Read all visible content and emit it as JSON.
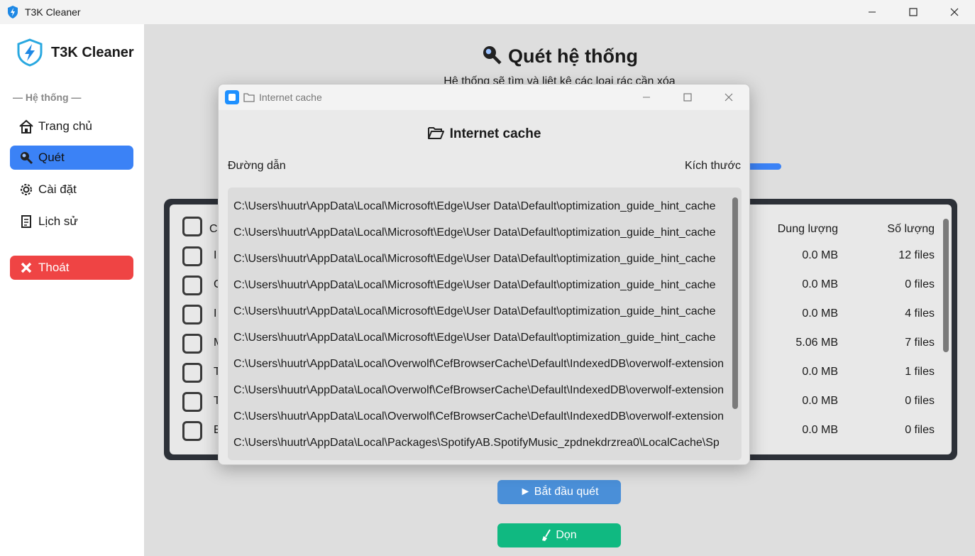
{
  "window": {
    "title": "T3K Cleaner",
    "icon": "lightning-shield-icon"
  },
  "sidebar": {
    "brand": "T3K Cleaner",
    "section_label": "— Hệ thống —",
    "items": [
      {
        "label": "Trang chủ",
        "icon": "house-icon"
      },
      {
        "label": "Quét",
        "icon": "magnifier-icon",
        "active": true
      },
      {
        "label": "Cài đặt",
        "icon": "gear-icon"
      },
      {
        "label": "Lịch sử",
        "icon": "scroll-icon"
      }
    ],
    "exit": {
      "label": "Thoát",
      "icon": "cross-icon"
    }
  },
  "main": {
    "title": "Quét hệ thống",
    "subtitle": "Hệ thống sẽ tìm và liệt kê các loại rác cần xóa",
    "table": {
      "headers": {
        "first": "Cl",
        "size": "Dung lượng",
        "count": "Số lượng"
      },
      "rows": [
        {
          "label": "I",
          "size": "0.0 MB",
          "count": "12 files"
        },
        {
          "label": "C",
          "size": "0.0 MB",
          "count": "0 files"
        },
        {
          "label": "I",
          "size": "0.0 MB",
          "count": "4 files"
        },
        {
          "label": "M",
          "size": "5.06 MB",
          "count": "7 files"
        },
        {
          "label": "T",
          "size": "0.0 MB",
          "count": "1 files"
        },
        {
          "label": "T",
          "size": "0.0 MB",
          "count": "0 files"
        },
        {
          "label": "E",
          "size": "0.0 MB",
          "count": "0 files"
        }
      ]
    },
    "scan_button": "► Bắt đầu quét",
    "clean_button": "Dọn"
  },
  "dialog": {
    "window_title": "Internet cache",
    "heading": "Internet cache",
    "col_path": "Đường dẫn",
    "col_size": "Kích thước",
    "paths": [
      "C:\\Users\\huutr\\AppData\\Local\\Microsoft\\Edge\\User Data\\Default\\optimization_guide_hint_cache",
      "C:\\Users\\huutr\\AppData\\Local\\Microsoft\\Edge\\User Data\\Default\\optimization_guide_hint_cache",
      "C:\\Users\\huutr\\AppData\\Local\\Microsoft\\Edge\\User Data\\Default\\optimization_guide_hint_cache",
      "C:\\Users\\huutr\\AppData\\Local\\Microsoft\\Edge\\User Data\\Default\\optimization_guide_hint_cache",
      "C:\\Users\\huutr\\AppData\\Local\\Microsoft\\Edge\\User Data\\Default\\optimization_guide_hint_cache",
      "C:\\Users\\huutr\\AppData\\Local\\Microsoft\\Edge\\User Data\\Default\\optimization_guide_hint_cache",
      "C:\\Users\\huutr\\AppData\\Local\\Overwolf\\CefBrowserCache\\Default\\IndexedDB\\overwolf-extension",
      "C:\\Users\\huutr\\AppData\\Local\\Overwolf\\CefBrowserCache\\Default\\IndexedDB\\overwolf-extension",
      "C:\\Users\\huutr\\AppData\\Local\\Overwolf\\CefBrowserCache\\Default\\IndexedDB\\overwolf-extension",
      "C:\\Users\\huutr\\AppData\\Local\\Packages\\SpotifyAB.SpotifyMusic_zpdnekdrzrea0\\LocalCache\\Sp"
    ]
  },
  "colors": {
    "accent": "#3b82f6",
    "danger": "#ef4444",
    "success": "#10b981",
    "scan_button": "#4a8fd8"
  }
}
